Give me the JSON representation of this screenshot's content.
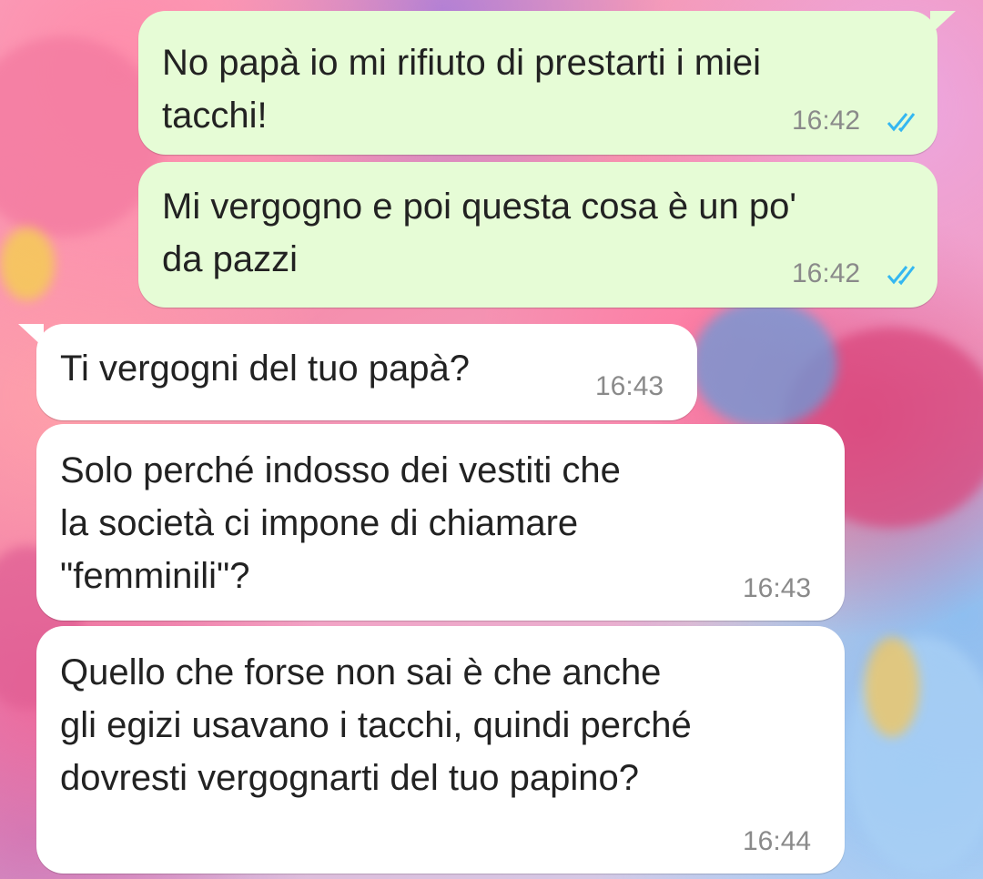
{
  "messages": [
    {
      "direction": "outgoing",
      "text": "No papà io mi rifiuto di prestarti i miei\ntacchi!",
      "time": "16:42",
      "status": "read"
    },
    {
      "direction": "outgoing",
      "text": "Mi vergogno e poi questa cosa è un po'\nda pazzi",
      "time": "16:42",
      "status": "read"
    },
    {
      "direction": "incoming",
      "text": "Ti vergogni del tuo papà?",
      "time": "16:43"
    },
    {
      "direction": "incoming",
      "text": "Solo perché indosso dei vestiti che\nla società ci impone di chiamare\n\"femminili\"?",
      "time": "16:43"
    },
    {
      "direction": "incoming",
      "text": "Quello che forse non sai è che anche\ngli egizi usavano i tacchi, quindi perché\ndovresti vergognarti del tuo papino?",
      "time": "16:44"
    }
  ],
  "colors": {
    "outgoing_bubble": "#e6fcd6",
    "incoming_bubble": "#ffffff",
    "read_ticks": "#34b7f1",
    "timestamp": "#8a8a8a",
    "text": "#222222"
  },
  "icons": {
    "read_receipt": "double-check-icon"
  }
}
